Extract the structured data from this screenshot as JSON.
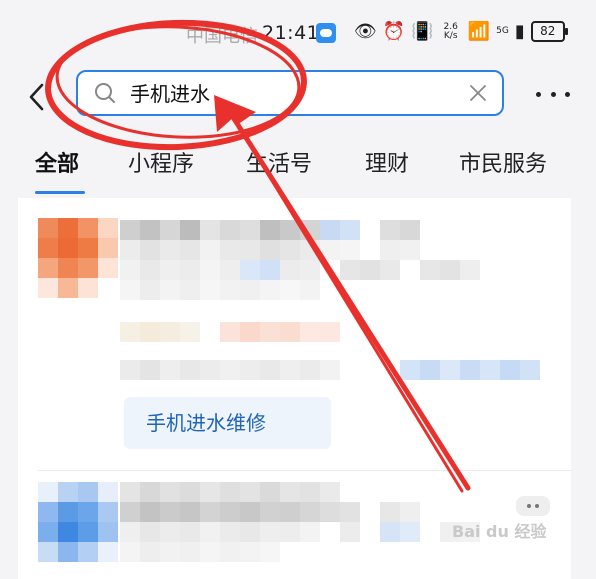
{
  "status_bar": {
    "carrier": "中国电信",
    "time": "21:41",
    "network_speed": "2.6 K/s",
    "signal": "5G",
    "battery": "82"
  },
  "search": {
    "query": "手机进水",
    "back_icon": "back-chevron-icon",
    "search_icon": "search-icon",
    "clear_icon": "clear-icon",
    "more_icon": "more-icon"
  },
  "tabs": [
    {
      "label": "全部",
      "active": true
    },
    {
      "label": "小程序",
      "active": false
    },
    {
      "label": "生活号",
      "active": false
    },
    {
      "label": "理财",
      "active": false
    },
    {
      "label": "市民服务",
      "active": false
    }
  ],
  "results": {
    "suggestion": "手机进水维修"
  },
  "annotation": {
    "color": "#e8312c"
  },
  "watermark": "Bai du 经验"
}
